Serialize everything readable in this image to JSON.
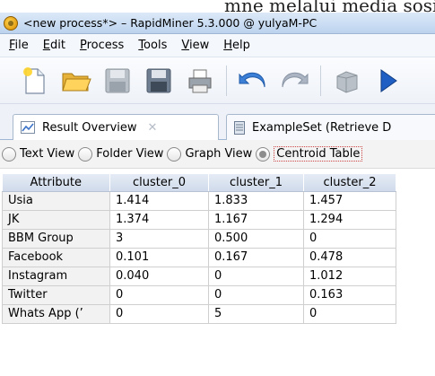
{
  "document_text": "mne melalui media sosial menggunaka",
  "window": {
    "title": "<new process*> – RapidMiner 5.3.000 @ yulyaM-PC"
  },
  "menubar": {
    "items": [
      {
        "mnemonic": "F",
        "rest": "ile"
      },
      {
        "mnemonic": "E",
        "rest": "dit"
      },
      {
        "mnemonic": "P",
        "rest": "rocess"
      },
      {
        "mnemonic": "T",
        "rest": "ools"
      },
      {
        "mnemonic": "V",
        "rest": "iew"
      },
      {
        "mnemonic": "H",
        "rest": "elp"
      }
    ]
  },
  "toolbar": {
    "icons": [
      "new-process-icon",
      "open-folder-icon",
      "save-icon",
      "save-as-icon",
      "print-icon",
      "undo-icon",
      "redo-icon",
      "operator-icon",
      "run-icon"
    ]
  },
  "tabs": [
    {
      "label": "Result Overview",
      "icon": "chart-icon"
    },
    {
      "label": "ExampleSet (Retrieve D",
      "icon": "database-icon"
    }
  ],
  "view_options": [
    {
      "label": "Text View",
      "checked": false
    },
    {
      "label": "Folder View",
      "checked": false
    },
    {
      "label": "Graph View",
      "checked": false
    },
    {
      "label": "Centroid Table",
      "checked": true
    }
  ],
  "table": {
    "headers": [
      "Attribute",
      "cluster_0",
      "cluster_1",
      "cluster_2"
    ],
    "rows": [
      [
        "Usia",
        "1.414",
        "1.833",
        "1.457"
      ],
      [
        "JK",
        "1.374",
        "1.167",
        "1.294"
      ],
      [
        "BBM Group",
        "3",
        "0.500",
        "0"
      ],
      [
        "Facebook",
        "0.101",
        "0.167",
        "0.478"
      ],
      [
        "Instagram",
        "0.040",
        "0",
        "1.012"
      ],
      [
        "Twitter",
        "0",
        "0",
        "0.163"
      ],
      [
        "Whats App (’",
        "0",
        "5",
        "0"
      ]
    ]
  }
}
